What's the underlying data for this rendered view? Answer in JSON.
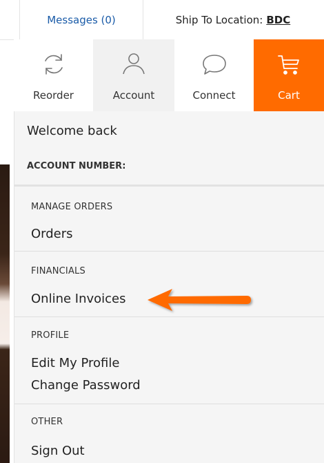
{
  "topbar": {
    "messages_label": "Messages (0)",
    "ship_prefix": "Ship To Location:",
    "ship_location": "BDC"
  },
  "nav": {
    "reorder": {
      "label": "Reorder",
      "icon": "refresh-icon"
    },
    "account": {
      "label": "Account",
      "icon": "user-icon"
    },
    "connect": {
      "label": "Connect",
      "icon": "chat-bubble-icon"
    },
    "cart": {
      "label": "Cart",
      "icon": "cart-icon"
    }
  },
  "account_menu": {
    "welcome": "Welcome back",
    "account_number_label": "ACCOUNT NUMBER:",
    "sections": [
      {
        "title": "MANAGE ORDERS",
        "links": [
          "Orders"
        ]
      },
      {
        "title": "FINANCIALS",
        "links": [
          "Online Invoices"
        ]
      },
      {
        "title": "PROFILE",
        "links": [
          "Edit My Profile",
          "Change Password"
        ]
      },
      {
        "title": "OTHER",
        "links": [
          "Sign Out"
        ]
      }
    ]
  },
  "colors": {
    "accent_orange": "#ff6b00",
    "link_blue": "#1a5ba8",
    "panel_bg": "#f5f5f5"
  },
  "annotation": {
    "icon": "orange-arrow-icon",
    "points_to": "Online Invoices"
  }
}
